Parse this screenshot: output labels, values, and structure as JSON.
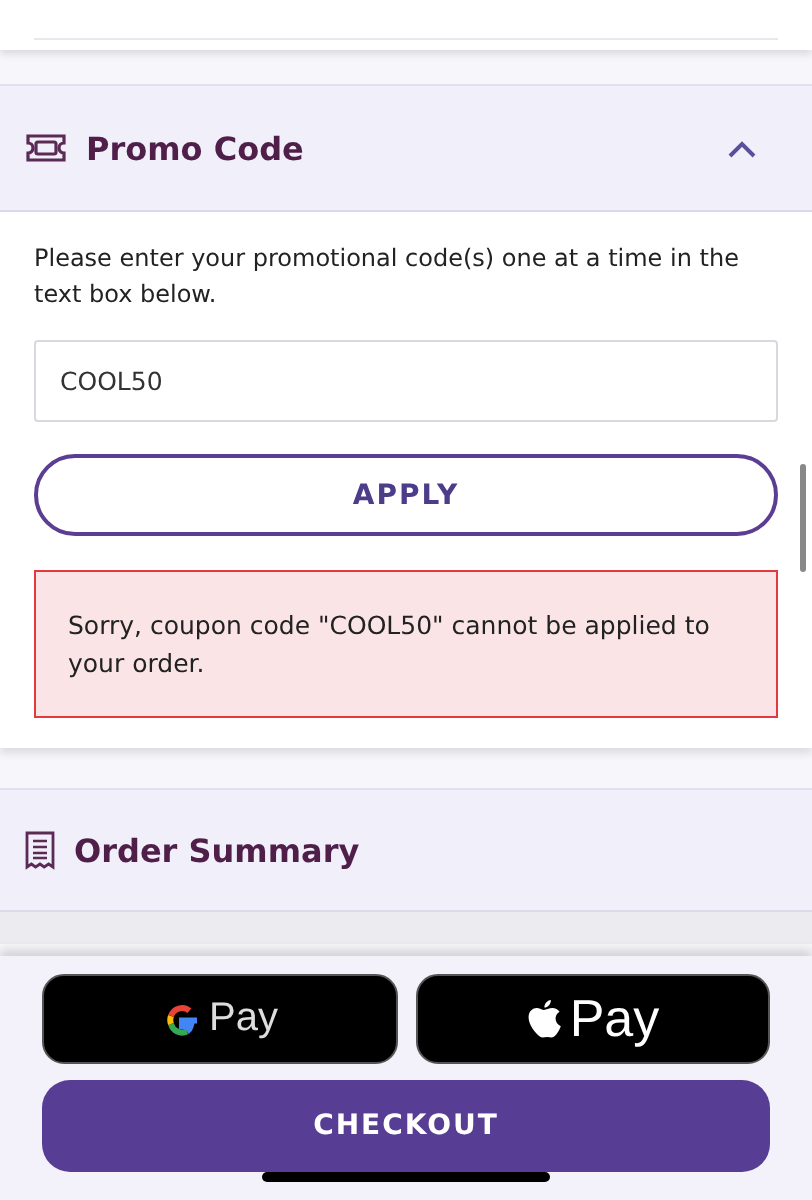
{
  "promo": {
    "title": "Promo Code",
    "expanded": true,
    "instructions": "Please enter your promotional code(s) one at a time in the text box below.",
    "code": "COOL50",
    "apply_button": "APPLY",
    "error": "Sorry, coupon code \"COOL50\" cannot be applied to your order."
  },
  "order_summary": {
    "title": "Order Summary"
  },
  "payment_buttons": [
    {
      "kind": "google",
      "label": "Pay"
    },
    {
      "kind": "apple",
      "label": "Pay"
    }
  ],
  "checkout_button": "CHECKOUT"
}
